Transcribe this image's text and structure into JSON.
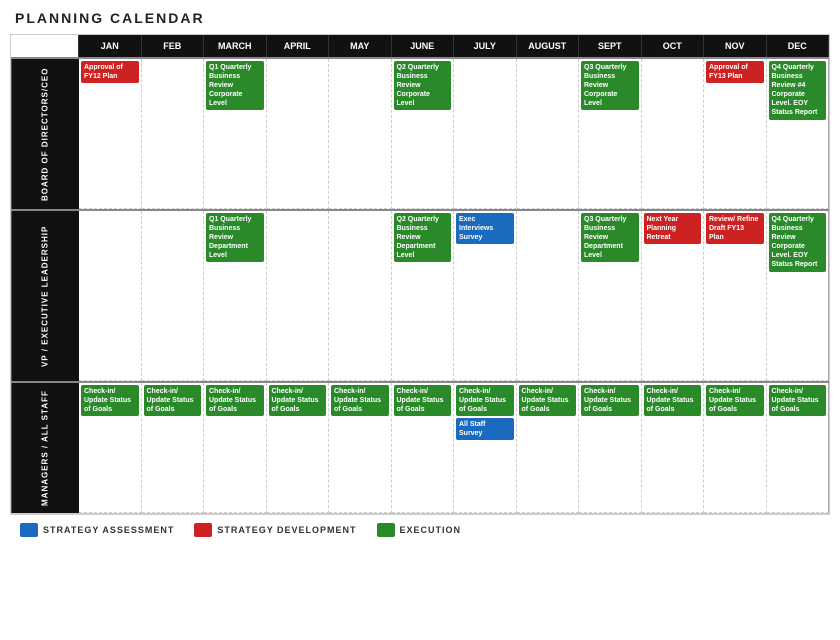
{
  "title": "PLANNING CALENDAR",
  "months": [
    "JAN",
    "FEB",
    "MARCH",
    "APRIL",
    "MAY",
    "JUNE",
    "JULY",
    "AUGUST",
    "SEPT",
    "OCT",
    "NOV",
    "DEC"
  ],
  "rows": [
    {
      "label": "BOARD OF DIRECTORS/CEO",
      "cells": [
        {
          "month": "JAN",
          "events": [
            {
              "type": "red",
              "text": "Approval of FY12 Plan"
            }
          ]
        },
        {
          "month": "FEB",
          "events": []
        },
        {
          "month": "MARCH",
          "events": [
            {
              "type": "green",
              "text": "Q1 Quarterly Business Review Corporate Level"
            }
          ]
        },
        {
          "month": "APRIL",
          "events": []
        },
        {
          "month": "MAY",
          "events": []
        },
        {
          "month": "JUNE",
          "events": [
            {
              "type": "green",
              "text": "Q2 Quarterly Business Review Corporate Level"
            }
          ]
        },
        {
          "month": "JULY",
          "events": []
        },
        {
          "month": "AUGUST",
          "events": []
        },
        {
          "month": "SEPT",
          "events": [
            {
              "type": "green",
              "text": "Q3 Quarterly Business Review Corporate Level"
            }
          ]
        },
        {
          "month": "OCT",
          "events": []
        },
        {
          "month": "NOV",
          "events": [
            {
              "type": "red",
              "text": "Approval of FY13 Plan"
            }
          ]
        },
        {
          "month": "DEC",
          "events": [
            {
              "type": "green",
              "text": "Q4 Quarterly Business Review #4 Corporate Level. EOY Status Report"
            }
          ]
        }
      ]
    },
    {
      "label": "VP / EXECUTIVE LEADERSHIP",
      "cells": [
        {
          "month": "JAN",
          "events": []
        },
        {
          "month": "FEB",
          "events": []
        },
        {
          "month": "MARCH",
          "events": [
            {
              "type": "green",
              "text": "Q1 Quarterly Business Review Department Level"
            }
          ]
        },
        {
          "month": "APRIL",
          "events": []
        },
        {
          "month": "MAY",
          "events": []
        },
        {
          "month": "JUNE",
          "events": [
            {
              "type": "green",
              "text": "Q2 Quarterly Business Review Department Level"
            }
          ]
        },
        {
          "month": "JULY",
          "events": [
            {
              "type": "blue",
              "text": "Exec Interviews Survey"
            }
          ]
        },
        {
          "month": "AUGUST",
          "events": []
        },
        {
          "month": "SEPT",
          "events": [
            {
              "type": "green",
              "text": "Q3 Quarterly Business Review Department Level"
            }
          ]
        },
        {
          "month": "OCT",
          "events": [
            {
              "type": "red",
              "text": "Next Year Planning Retreat"
            }
          ]
        },
        {
          "month": "NOV",
          "events": [
            {
              "type": "red",
              "text": "Review/ Refine Draft FY13 Plan"
            }
          ]
        },
        {
          "month": "DEC",
          "events": [
            {
              "type": "green",
              "text": "Q4 Quarterly Business Review Corporate Level. EOY Status Report"
            }
          ]
        }
      ]
    },
    {
      "label": "MANAGERS / ALL STAFF",
      "cells": [
        {
          "month": "JAN",
          "events": [
            {
              "type": "green",
              "text": "Check-in/ Update Status of Goals"
            }
          ]
        },
        {
          "month": "FEB",
          "events": [
            {
              "type": "green",
              "text": "Check-in/ Update Status of Goals"
            }
          ]
        },
        {
          "month": "MARCH",
          "events": [
            {
              "type": "green",
              "text": "Check-in/ Update Status of Goals"
            }
          ]
        },
        {
          "month": "APRIL",
          "events": [
            {
              "type": "green",
              "text": "Check-in/ Update Status of Goals"
            }
          ]
        },
        {
          "month": "MAY",
          "events": [
            {
              "type": "green",
              "text": "Check-in/ Update Status of Goals"
            }
          ]
        },
        {
          "month": "JUNE",
          "events": [
            {
              "type": "green",
              "text": "Check-in/ Update Status of Goals"
            }
          ]
        },
        {
          "month": "JULY",
          "events": [
            {
              "type": "green",
              "text": "Check-in/ Update Status of Goals"
            },
            {
              "type": "blue",
              "text": "All Staff Survey"
            }
          ]
        },
        {
          "month": "AUGUST",
          "events": [
            {
              "type": "green",
              "text": "Check-in/ Update Status of Goals"
            }
          ]
        },
        {
          "month": "SEPT",
          "events": [
            {
              "type": "green",
              "text": "Check-in/ Update Status of Goals"
            }
          ]
        },
        {
          "month": "OCT",
          "events": [
            {
              "type": "green",
              "text": "Check-in/ Update Status of Goals"
            }
          ]
        },
        {
          "month": "NOV",
          "events": [
            {
              "type": "green",
              "text": "Check-in/ Update Status of Goals"
            }
          ]
        },
        {
          "month": "DEC",
          "events": [
            {
              "type": "green",
              "text": "Check-in/ Update Status of Goals"
            }
          ]
        }
      ]
    }
  ],
  "legend": [
    {
      "type": "blue",
      "label": "STRATEGY ASSESSMENT"
    },
    {
      "type": "red",
      "label": "STRATEGY DEVELOPMENT"
    },
    {
      "type": "green",
      "label": "EXECUTION"
    }
  ]
}
